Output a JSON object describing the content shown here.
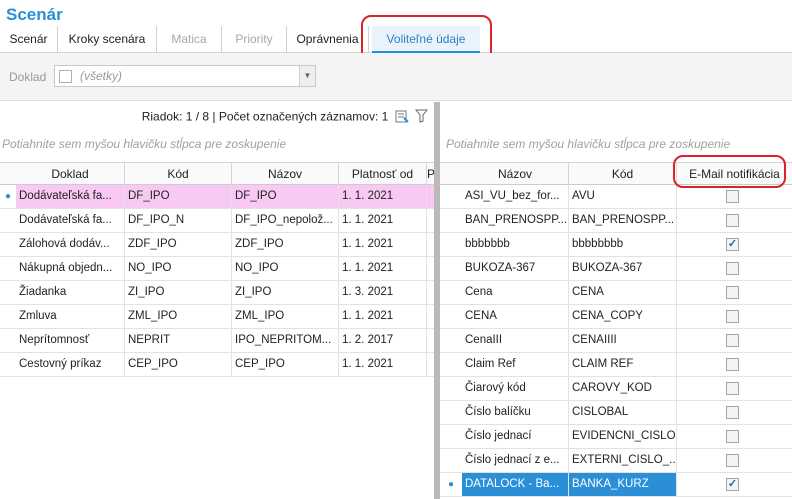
{
  "app": {
    "title": "Scenár"
  },
  "tabs": [
    {
      "label": "Scenár",
      "state": "normal"
    },
    {
      "label": "Kroky scenára",
      "state": "normal"
    },
    {
      "label": "Matica",
      "state": "disabled"
    },
    {
      "label": "Priority",
      "state": "disabled"
    },
    {
      "label": "Oprávnenia",
      "state": "normal"
    },
    {
      "label": "Voliteľné údaje",
      "state": "active"
    }
  ],
  "filter": {
    "label": "Doklad",
    "value": "(všetky)"
  },
  "left": {
    "status": "Riadok: 1 / 8 | Počet označených záznamov: 1",
    "group_hint": "Potiahnite sem myšou hlavičku stĺpca pre zoskupenie",
    "columns": [
      "Doklad",
      "Kód",
      "Názov",
      "Platnosť od",
      "P"
    ],
    "rows": [
      {
        "doklad": "Dodávateľská fa...",
        "kod": "DF_IPO",
        "nazov": "DF_IPO",
        "platnost": "1. 1. 2021",
        "state": "pink"
      },
      {
        "doklad": "Dodávateľská fa...",
        "kod": "DF_IPO_N",
        "nazov": "DF_IPO_nepolož...",
        "platnost": "1. 1. 2021",
        "state": ""
      },
      {
        "doklad": "Zálohová dodáv...",
        "kod": "ZDF_IPO",
        "nazov": "ZDF_IPO",
        "platnost": "1. 1. 2021",
        "state": ""
      },
      {
        "doklad": "Nákupná objedn...",
        "kod": "NO_IPO",
        "nazov": "NO_IPO",
        "platnost": "1. 1. 2021",
        "state": ""
      },
      {
        "doklad": "Žiadanka",
        "kod": "ZI_IPO",
        "nazov": "ZI_IPO",
        "platnost": "1. 3. 2021",
        "state": ""
      },
      {
        "doklad": "Zmluva",
        "kod": "ZML_IPO",
        "nazov": "ZML_IPO",
        "platnost": "1. 1. 2021",
        "state": ""
      },
      {
        "doklad": "Neprítomnosť",
        "kod": "NEPRIT",
        "nazov": "IPO_NEPRITOM...",
        "platnost": "1. 2. 2017",
        "state": ""
      },
      {
        "doklad": "Cestovný príkaz",
        "kod": "CEP_IPO",
        "nazov": "CEP_IPO",
        "platnost": "1. 1. 2021",
        "state": ""
      }
    ]
  },
  "right": {
    "group_hint": "Potiahnite sem myšou hlavičku stĺpca pre zoskupenie",
    "columns": [
      "Názov",
      "Kód",
      "E-Mail notifikácia"
    ],
    "rows": [
      {
        "nazov": "ASI_VU_bez_for...",
        "kod": "AVU",
        "email": false,
        "state": ""
      },
      {
        "nazov": "BAN_PRENOSPP...",
        "kod": "BAN_PRENOSPP...",
        "email": false,
        "state": ""
      },
      {
        "nazov": "bbbbbbb",
        "kod": "bbbbbbbb",
        "email": true,
        "state": ""
      },
      {
        "nazov": "BUKOZA-367",
        "kod": "BUKOZA-367",
        "email": false,
        "state": ""
      },
      {
        "nazov": "Cena",
        "kod": "CENA",
        "email": false,
        "state": ""
      },
      {
        "nazov": "CENA",
        "kod": "CENA_COPY",
        "email": false,
        "state": ""
      },
      {
        "nazov": "CenaIII",
        "kod": "CENAIIII",
        "email": false,
        "state": ""
      },
      {
        "nazov": "Claim Ref",
        "kod": "CLAIM REF",
        "email": false,
        "state": ""
      },
      {
        "nazov": "Čiarový kód",
        "kod": "CAROVY_KOD",
        "email": false,
        "state": ""
      },
      {
        "nazov": "Číslo balíčku",
        "kod": "CISLOBAL",
        "email": false,
        "state": ""
      },
      {
        "nazov": "Číslo jednací",
        "kod": "EVIDENCNI_CISLO",
        "email": false,
        "state": ""
      },
      {
        "nazov": "Číslo jednací z e...",
        "kod": "EXTERNI_CISLO_...",
        "email": false,
        "state": ""
      },
      {
        "nazov": "DATALOCK - Ba...",
        "kod": "BANKA_KURZ",
        "email": true,
        "state": "sel"
      }
    ]
  },
  "colors": {
    "accent": "#2a8fd4",
    "highlight": "#d9222a",
    "pink": "#f7c9f3",
    "selected": "#2b8fd8"
  }
}
